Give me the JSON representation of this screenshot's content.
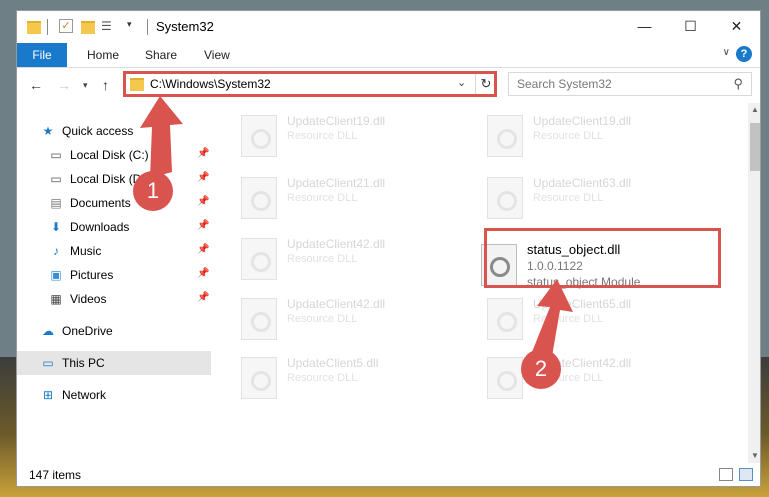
{
  "window": {
    "title": "System32"
  },
  "ribbon": {
    "file": "File",
    "tabs": [
      "Home",
      "Share",
      "View"
    ],
    "help": "?"
  },
  "address": {
    "path": "C:\\Windows\\System32"
  },
  "search": {
    "placeholder": "Search System32"
  },
  "nav": {
    "quick_access": "Quick access",
    "items": [
      "Local Disk (C:)",
      "Local Disk (D:)",
      "Documents",
      "Downloads",
      "Music",
      "Pictures",
      "Videos"
    ],
    "onedrive": "OneDrive",
    "this_pc": "This PC",
    "network": "Network"
  },
  "files": [
    {
      "name": "UpdateClient19.dll",
      "desc": "Resource DLL"
    },
    {
      "name": "UpdateClient19.dll",
      "desc": "Resource DLL"
    },
    {
      "name": "UpdateClient21.dll",
      "desc": "Resource DLL"
    },
    {
      "name": "UpdateClient63.dll",
      "desc": "Resource DLL"
    },
    {
      "name": "UpdateClient42.dll",
      "desc": "Resource DLL"
    },
    {
      "name": "UpdateClient42.dll",
      "desc": "Resource DLL"
    },
    {
      "name": "UpdateClient65.dll",
      "desc": "Resource DLL"
    },
    {
      "name": "UpdateClient5.dll",
      "desc": "Resource DLL"
    },
    {
      "name": "UpdateClient42.dll",
      "desc": "Resource DLL"
    }
  ],
  "selected_file": {
    "name": "status_object.dll",
    "version": "1.0.0.1122",
    "desc": "status_object Module"
  },
  "status": {
    "count": "147 items"
  },
  "annotations": {
    "step1": "1",
    "step2": "2"
  },
  "colors": {
    "accent": "#1979ca",
    "highlight": "#d9534f"
  }
}
